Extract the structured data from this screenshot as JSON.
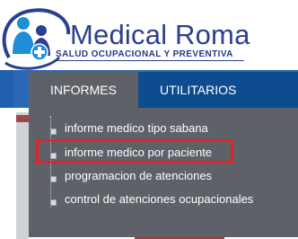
{
  "logo": {
    "title": "Medical Roma",
    "subtitle": "SALUD OCUPACIONAL Y PREVENTIVA"
  },
  "nav": {
    "tabs": [
      {
        "label": "INFORMES",
        "active": true
      },
      {
        "label": "UTILITARIOS",
        "active": false
      }
    ]
  },
  "menu": {
    "items": [
      {
        "label": "informe medico tipo sabana"
      },
      {
        "label": "informe medico por paciente",
        "highlighted": true
      },
      {
        "label": "programacion de atenciones"
      },
      {
        "label": "control de atenciones ocupacionales"
      }
    ]
  },
  "colors": {
    "nav_bg": "#0d4d8f",
    "menu_bg": "#5e6168",
    "brand_blue": "#2a3f8f",
    "highlight_border": "#e0242b"
  }
}
